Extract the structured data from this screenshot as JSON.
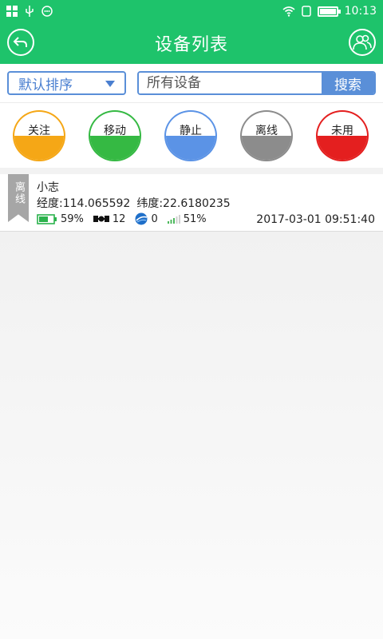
{
  "statusbar": {
    "time": "10:13"
  },
  "header": {
    "title": "设备列表"
  },
  "search": {
    "sort_label": "默认排序",
    "placeholder": "所有设备",
    "button_label": "搜索"
  },
  "filters": [
    {
      "label": "关注",
      "color": "#f5a716"
    },
    {
      "label": "移动",
      "color": "#35b943"
    },
    {
      "label": "静止",
      "color": "#5b93e6"
    },
    {
      "label": "离线",
      "color": "#8c8c8c"
    },
    {
      "label": "未用",
      "color": "#e41f1f"
    }
  ],
  "devices": [
    {
      "status": "离线",
      "name": "小志",
      "longitude_label": "经度:114.065592",
      "latitude_label": "纬度:22.6180235",
      "battery": "59%",
      "satellites": "12",
      "stations": "0",
      "signal": "51%",
      "time": "2017-03-01 09:51:40"
    }
  ],
  "icons": {
    "back": "back-arrow-icon",
    "users": "users-icon",
    "battery": "battery-icon",
    "satellite": "satellite-icon",
    "station": "globe-icon",
    "signal": "signal-icon"
  }
}
